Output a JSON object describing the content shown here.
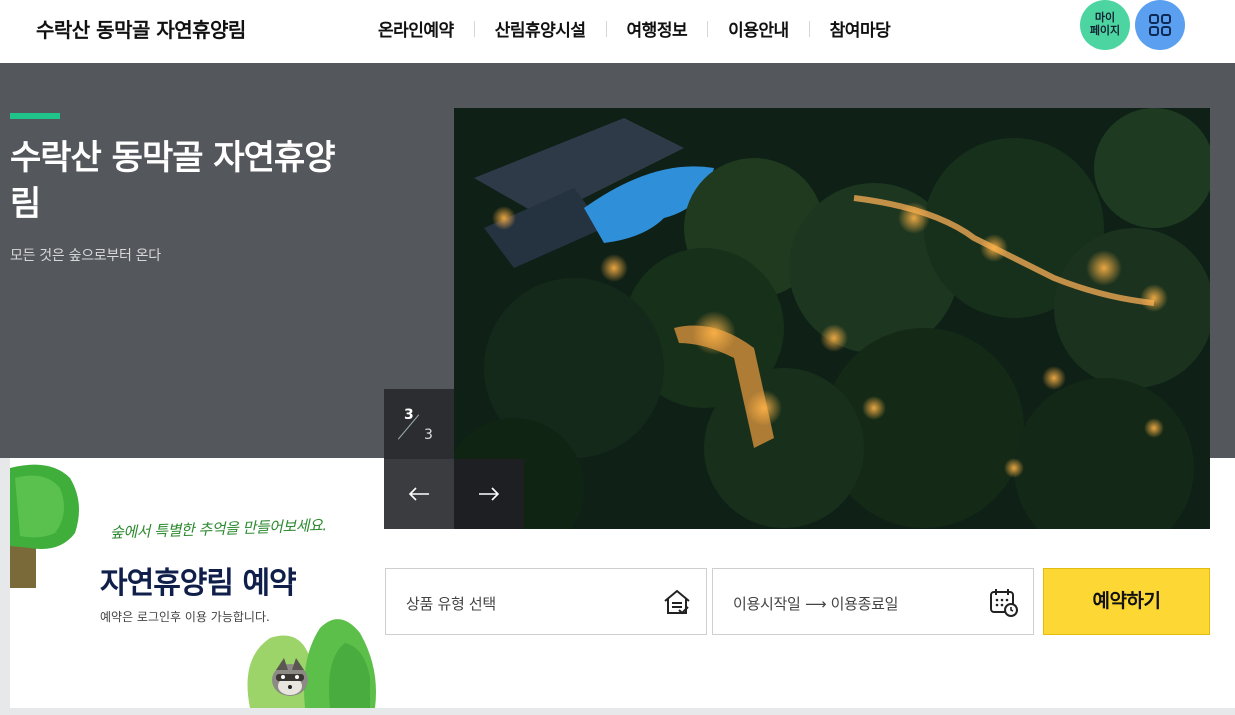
{
  "header": {
    "site_title": "수락산 동막골 자연휴양림",
    "nav": [
      {
        "label": "온라인예약"
      },
      {
        "label": "산림휴양시설"
      },
      {
        "label": "여행정보"
      },
      {
        "label": "이용안내"
      },
      {
        "label": "참여마당"
      }
    ],
    "mypage_line1": "마이",
    "mypage_line2": "페이지",
    "mypage_icon": "mypage-circle",
    "menu_icon": "grid-icon"
  },
  "hero": {
    "title": "수락산 동막골 자연휴양림",
    "subtitle": "모든 것은 숲으로부터 온다",
    "pager_current": "3",
    "pager_total": "3",
    "prev_icon": "arrow-left-icon",
    "next_icon": "arrow-right-icon",
    "photo": "night-aerial-forest-photo"
  },
  "reservation": {
    "slogan": "숲에서 특별한 추억을 만들어보세요.",
    "title": "자연휴양림 예약",
    "note": "예약은 로그인후 이용 가능합니다.",
    "type_placeholder": "상품 유형 선택",
    "date_placeholder": "이용시작일 ⟶ 이용종료일",
    "reserve_label": "예약하기"
  },
  "colors": {
    "accent_green": "#1fc48a",
    "mypage_bg": "#4dd5a1",
    "menu_bg": "#5b9ff0",
    "hero_bg": "#54575c",
    "reserve_btn": "#fdd835",
    "title_navy": "#0f1f4a"
  }
}
